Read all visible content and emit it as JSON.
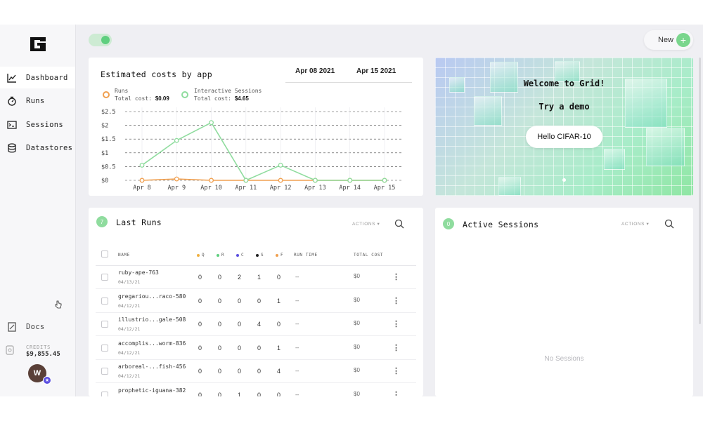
{
  "sidebar": {
    "items": [
      {
        "label": "Dashboard",
        "icon": "chart-line-icon",
        "active": true
      },
      {
        "label": "Runs",
        "icon": "stopwatch-icon"
      },
      {
        "label": "Sessions",
        "icon": "terminal-icon"
      },
      {
        "label": "Datastores",
        "icon": "database-icon"
      }
    ],
    "docs_label": "Docs",
    "credits_label": "CREDITS",
    "credits_value": "$9,855.45",
    "avatar_initial": "W"
  },
  "header": {
    "new_label": "New",
    "new_icon": "plus-icon"
  },
  "costs": {
    "title": "Estimated costs by app",
    "date_from": "Apr 08 2021",
    "date_to": "Apr 15 2021",
    "legend": [
      {
        "name": "Runs",
        "cost_label": "Total cost:",
        "cost": "$0.09",
        "color": "#f0a050"
      },
      {
        "name": "Interactive Sessions",
        "cost_label": "Total cost:",
        "cost": "$4.65",
        "color": "#8fdc9e"
      }
    ]
  },
  "chart_data": {
    "type": "line",
    "x": [
      "Apr 8",
      "Apr 9",
      "Apr 10",
      "Apr 11",
      "Apr 12",
      "Apr 13",
      "Apr 14",
      "Apr 15"
    ],
    "y_ticks": [
      "$0",
      "$0.5",
      "$1",
      "$1.5",
      "$2",
      "$2.5"
    ],
    "ylim": [
      0,
      2.5
    ],
    "grid": true,
    "series": [
      {
        "name": "Runs",
        "color": "#f0a050",
        "values": [
          0,
          0.05,
          0,
          0,
          0,
          0,
          0,
          0
        ]
      },
      {
        "name": "Interactive Sessions",
        "color": "#8fdc9e",
        "values": [
          0.55,
          1.45,
          2.1,
          0,
          0.55,
          0,
          0,
          0
        ]
      }
    ]
  },
  "welcome": {
    "title": "Welcome to Grid!",
    "subtitle": "Try a demo",
    "demo_button": "Hello CIFAR-10"
  },
  "runs": {
    "count": "7",
    "title": "Last Runs",
    "actions_label": "ACTIONS",
    "columns": {
      "name": "NAME",
      "q": "Q",
      "r": "R",
      "c": "C",
      "s": "S",
      "f": "F",
      "run_time": "RUN TIME",
      "total_cost": "TOTAL COST"
    },
    "status_colors": {
      "q": "#f0b040",
      "r": "#5fcf7f",
      "c": "#5b4fe0",
      "s": "#222222",
      "f": "#f0a050"
    },
    "rows": [
      {
        "name": "ruby-ape-763",
        "date": "04/13/21",
        "q": "0",
        "r": "0",
        "c": "2",
        "s": "1",
        "f": "0",
        "run_time": "--",
        "cost": "$0"
      },
      {
        "name": "gregariou...raco-580",
        "date": "04/12/21",
        "q": "0",
        "r": "0",
        "c": "0",
        "s": "0",
        "f": "1",
        "run_time": "--",
        "cost": "$0"
      },
      {
        "name": "illustrio...gale-508",
        "date": "04/12/21",
        "q": "0",
        "r": "0",
        "c": "0",
        "s": "4",
        "f": "0",
        "run_time": "--",
        "cost": "$0"
      },
      {
        "name": "accomplis...worm-836",
        "date": "04/12/21",
        "q": "0",
        "r": "0",
        "c": "0",
        "s": "0",
        "f": "1",
        "run_time": "--",
        "cost": "$0"
      },
      {
        "name": "arboreal-...fish-456",
        "date": "04/12/21",
        "q": "0",
        "r": "0",
        "c": "0",
        "s": "0",
        "f": "4",
        "run_time": "--",
        "cost": "$0"
      },
      {
        "name": "prophetic-iguana-382",
        "date": "",
        "q": "0",
        "r": "0",
        "c": "1",
        "s": "0",
        "f": "0",
        "run_time": "--",
        "cost": "$0"
      }
    ]
  },
  "sessions": {
    "count": "0",
    "title": "Active Sessions",
    "actions_label": "ACTIONS",
    "empty_text": "No Sessions"
  }
}
